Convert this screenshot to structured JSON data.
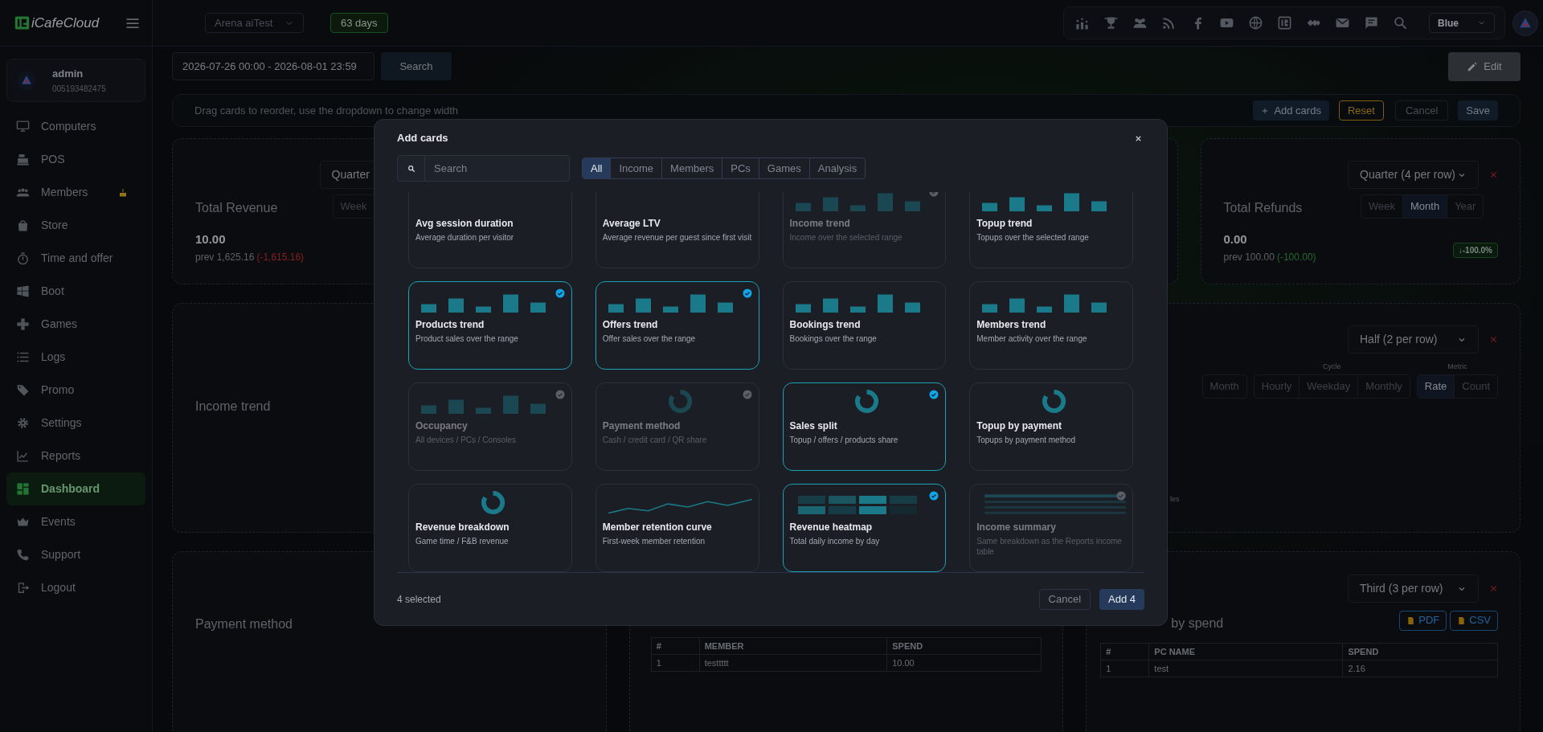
{
  "topbar": {
    "brand": "iCafeCloud",
    "branch": "Arena aiTest",
    "days_badge": "63 days",
    "theme": "Blue"
  },
  "user": {
    "name": "admin",
    "id": "005193482475"
  },
  "sidebar": {
    "items": [
      {
        "label": "Computers",
        "selected": false,
        "badge": false
      },
      {
        "label": "POS",
        "selected": false,
        "badge": false
      },
      {
        "label": "Members",
        "selected": false,
        "badge": true
      },
      {
        "label": "Store",
        "selected": false,
        "badge": false
      },
      {
        "label": "Time and offer",
        "selected": false,
        "badge": false
      },
      {
        "label": "Boot",
        "selected": false,
        "badge": false
      },
      {
        "label": "Games",
        "selected": false,
        "badge": false
      },
      {
        "label": "Logs",
        "selected": false,
        "badge": false
      },
      {
        "label": "Promo",
        "selected": false,
        "badge": false
      },
      {
        "label": "Settings",
        "selected": false,
        "badge": false
      },
      {
        "label": "Reports",
        "selected": false,
        "badge": false
      },
      {
        "label": "Dashboard",
        "selected": true,
        "badge": false
      },
      {
        "label": "Events",
        "selected": false,
        "badge": false
      },
      {
        "label": "Support",
        "selected": false,
        "badge": false
      },
      {
        "label": "Logout",
        "selected": false,
        "badge": false
      }
    ]
  },
  "date_range": "2026-07-26 00:00 - 2026-08-01 23:59",
  "search_button": "Search",
  "edit_button": "Edit",
  "toolbar": {
    "hint": "Drag cards to reorder, use the dropdown to change width",
    "add_cards": "Add cards",
    "reset": "Reset",
    "cancel": "Cancel",
    "save": "Save"
  },
  "dashboard": {
    "revenue_card": {
      "title": "Total Revenue",
      "value": "10.00",
      "prev": "prev 1,625.16",
      "delta": "(-1,615.16)",
      "delta_favorable": false,
      "width_select": "Quarter",
      "tabs": [
        {
          "label": "Week",
          "selected": false
        }
      ]
    },
    "refunds_card": {
      "title": "Total Refunds",
      "value": "0.00",
      "prev": "prev 100.00",
      "delta": "(-100.00)",
      "delta_favorable": true,
      "width_select": "Quarter (4 per row)",
      "tabs": [
        {
          "label": "Week",
          "selected": false
        },
        {
          "label": "Month",
          "selected": true
        },
        {
          "label": "Year",
          "selected": false
        }
      ],
      "badge": "↓-100.0%"
    },
    "income_trend_card": {
      "title": "Income trend"
    },
    "occupancy_card": {
      "width_select": "Half (2 per row)",
      "range_tabs": [
        {
          "label": "Month",
          "selected": false
        }
      ],
      "cycle_label": "Cycle",
      "cycle_tabs": [
        {
          "label": "Hourly",
          "selected": false
        },
        {
          "label": "Weekday",
          "selected": false
        },
        {
          "label": "Monthly",
          "selected": false
        }
      ],
      "metric_label": "Metric",
      "metric_tabs": [
        {
          "label": "Rate",
          "selected": true
        },
        {
          "label": "Count",
          "selected": false
        }
      ],
      "legend_fragment": "les"
    },
    "payment_card": {
      "title": "Payment method"
    },
    "members_spend_card": {
      "columns": [
        "#",
        "MEMBER",
        "SPEND"
      ],
      "rows": [
        [
          "1",
          "testtttt",
          "10.00"
        ]
      ]
    },
    "pcs_spend_card": {
      "title": "by spend",
      "width_select": "Third (3 per row)",
      "pdf": "PDF",
      "csv": "CSV",
      "columns": [
        "#",
        "PC NAME",
        "SPEND"
      ],
      "rows": [
        [
          "1",
          "test",
          "2.16"
        ]
      ]
    }
  },
  "modal": {
    "title": "Add cards",
    "search_placeholder": "Search",
    "filters": [
      {
        "label": "All",
        "selected": true
      },
      {
        "label": "Income",
        "selected": false
      },
      {
        "label": "Members",
        "selected": false
      },
      {
        "label": "PCs",
        "selected": false
      },
      {
        "label": "Games",
        "selected": false
      },
      {
        "label": "Analysis",
        "selected": false
      }
    ],
    "cards": [
      {
        "title": "Avg session duration",
        "description": "Average duration per visitor",
        "kind": "stat",
        "selected": false,
        "added": false
      },
      {
        "title": "Average LTV",
        "description": "Average revenue per guest since first visit",
        "kind": "stat",
        "selected": false,
        "added": false
      },
      {
        "title": "Income trend",
        "description": "Income over the selected range",
        "kind": "bars",
        "selected": false,
        "added": true
      },
      {
        "title": "Topup trend",
        "description": "Topups over the selected range",
        "kind": "bars",
        "selected": false,
        "added": false
      },
      {
        "title": "Products trend",
        "description": "Product sales over the range",
        "kind": "bars",
        "selected": true,
        "added": false
      },
      {
        "title": "Offers trend",
        "description": "Offer sales over the range",
        "kind": "bars",
        "selected": true,
        "added": false
      },
      {
        "title": "Bookings trend",
        "description": "Bookings over the range",
        "kind": "bars",
        "selected": false,
        "added": false
      },
      {
        "title": "Members trend",
        "description": "Member activity over the range",
        "kind": "bars",
        "selected": false,
        "added": false
      },
      {
        "title": "Occupancy",
        "description": "All devices / PCs / Consoles",
        "kind": "bars",
        "selected": false,
        "added": true
      },
      {
        "title": "Payment method",
        "description": "Cash / credit card / QR share",
        "kind": "donut",
        "selected": false,
        "added": true
      },
      {
        "title": "Sales split",
        "description": "Topup / offers / products share",
        "kind": "donut",
        "selected": true,
        "added": false
      },
      {
        "title": "Topup by payment",
        "description": "Topups by payment method",
        "kind": "donut",
        "selected": false,
        "added": false
      },
      {
        "title": "Revenue breakdown",
        "description": "Game time / F&B revenue",
        "kind": "donut",
        "selected": false,
        "added": false
      },
      {
        "title": "Member retention curve",
        "description": "First-week member retention",
        "kind": "line",
        "selected": false,
        "added": false
      },
      {
        "title": "Revenue heatmap",
        "description": "Total daily income by day",
        "kind": "heatmap",
        "selected": true,
        "added": false
      },
      {
        "title": "Income summary",
        "description": "Same breakdown as the Reports income table",
        "kind": "table",
        "selected": false,
        "added": true
      }
    ],
    "selected_count": "4 selected",
    "cancel": "Cancel",
    "confirm": "Add 4"
  }
}
